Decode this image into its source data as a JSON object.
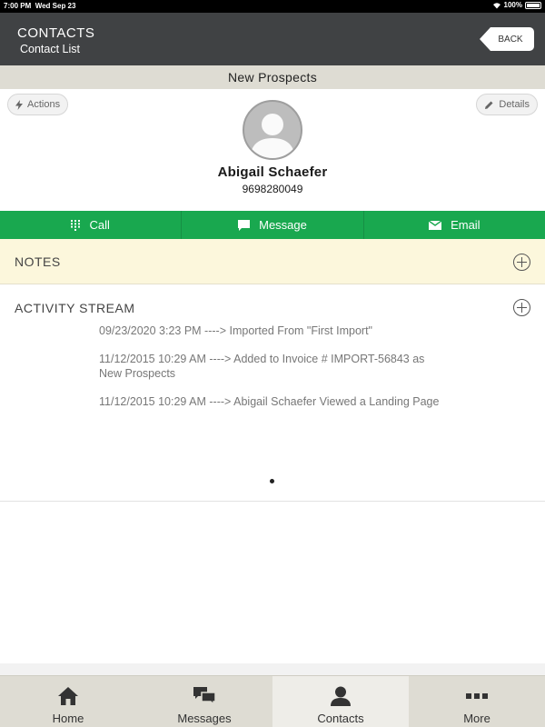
{
  "status": {
    "time": "7:00 PM",
    "date": "Wed Sep 23",
    "battery": "100%"
  },
  "header": {
    "title": "CONTACTS",
    "subtitle": "Contact List",
    "back_label": "BACK"
  },
  "group": "New Prospects",
  "actions_label": "Actions",
  "details_label": "Details",
  "contact": {
    "name": "Abigail Schaefer",
    "phone": "9698280049"
  },
  "action_bar": {
    "call": "Call",
    "message": "Message",
    "email": "Email"
  },
  "notes": {
    "label": "NOTES"
  },
  "activity": {
    "label": "ACTIVITY STREAM",
    "items": [
      "09/23/2020 3:23 PM ----> Imported From \"First Import\"",
      "11/12/2015 10:29 AM ----> Added to Invoice # IMPORT-56843 as New Prospects",
      "11/12/2015 10:29 AM ----> Abigail Schaefer Viewed a Landing Page"
    ]
  },
  "tabs": [
    {
      "label": "Home",
      "icon": "home-icon"
    },
    {
      "label": "Messages",
      "icon": "messages-icon"
    },
    {
      "label": "Contacts",
      "icon": "contacts-icon",
      "active": true
    },
    {
      "label": "More",
      "icon": "more-icon"
    }
  ],
  "colors": {
    "header_bg": "#404244",
    "action_green": "#19a84f",
    "notes_bg": "#fcf7dc",
    "tab_bar_bg": "#dedcd3"
  }
}
